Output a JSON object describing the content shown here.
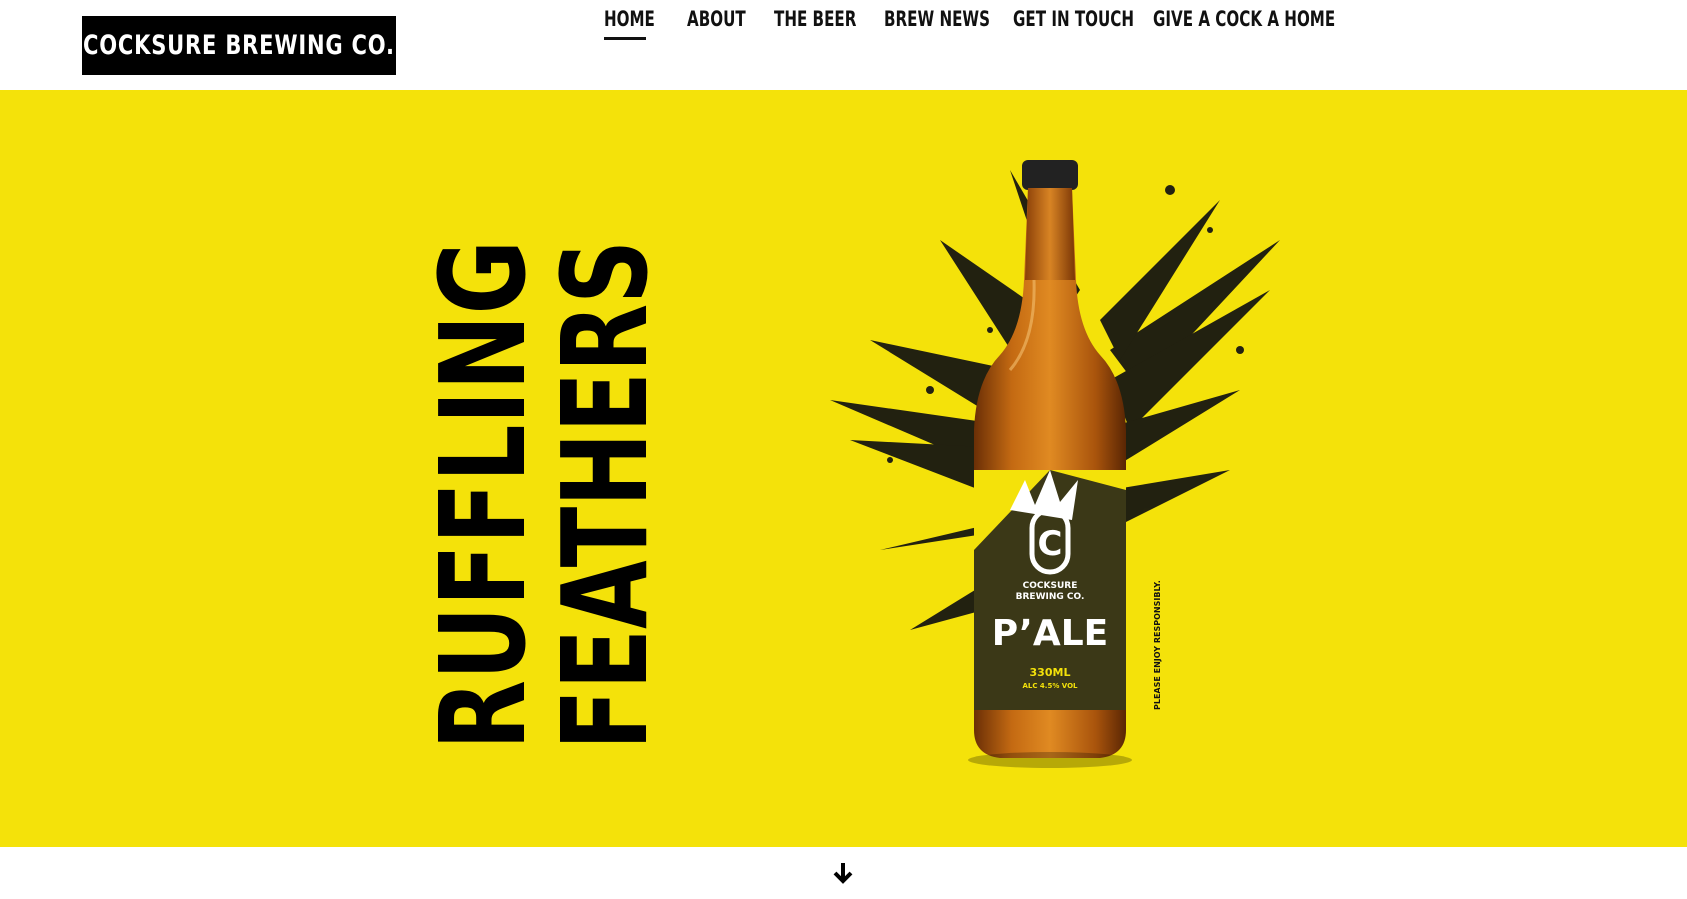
{
  "brand": {
    "logo_text": "COCKSURE BREWING CO.",
    "colors": {
      "yellow": "#f4e20a",
      "black": "#000000",
      "white": "#ffffff"
    }
  },
  "nav": {
    "items": [
      {
        "label": "HOME",
        "active": true
      },
      {
        "label": "ABOUT",
        "active": false
      },
      {
        "label": "THE BEER",
        "active": false
      },
      {
        "label": "BREW NEWS",
        "active": false
      },
      {
        "label": "GET IN TOUCH",
        "active": false
      },
      {
        "label": "GIVE A COCK A HOME",
        "active": false
      }
    ]
  },
  "hero": {
    "headline_line1": "RUFFLING",
    "headline_line2": "FEATHERS",
    "bottle_label": {
      "brand_line1": "COCKSURE",
      "brand_line2": "BREWING CO.",
      "monogram": "C",
      "product_name": "P’ALE",
      "volume": "330ML",
      "abv": "ALC 4.5% VOL",
      "side_text": "PLEASE ENJOY RESPONSIBLY."
    }
  },
  "scroll": {
    "icon": "arrow-down-icon"
  }
}
